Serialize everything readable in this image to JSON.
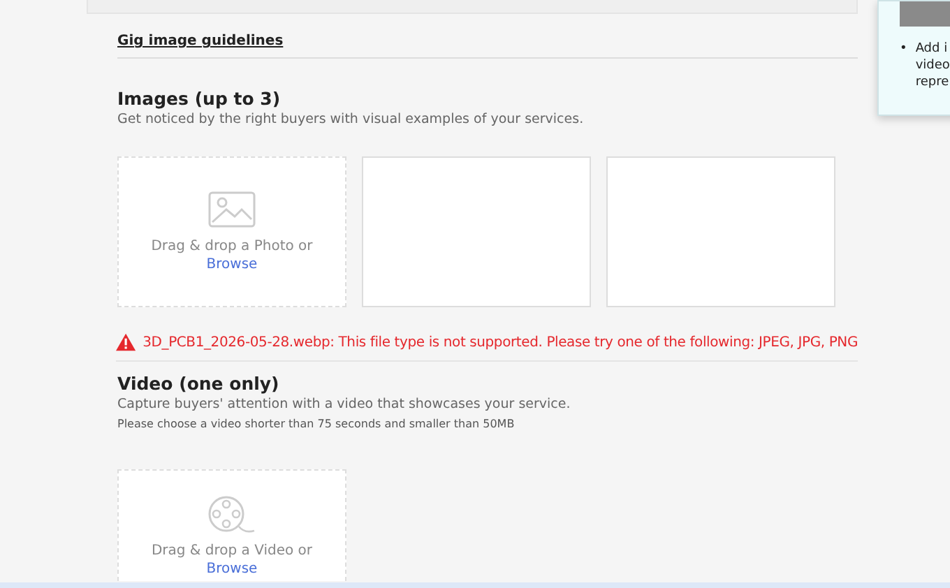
{
  "guidelines_link": "Gig image guidelines",
  "tip_panel": {
    "bullet": "•",
    "bullet_lines": [
      "Add i",
      "video",
      "repre"
    ]
  },
  "images": {
    "title": "Images (up to 3)",
    "subtitle": "Get noticed by the right buyers with visual examples of your services.",
    "slots": [
      {
        "kind": "upload",
        "prompt": "Drag & drop a Photo or",
        "link": "Browse"
      },
      {
        "kind": "empty"
      },
      {
        "kind": "empty"
      }
    ],
    "error": "3D_PCB1_2026-05-28.webp: This file type is not supported. Please try one of the following: JPEG, JPG, PNG"
  },
  "video": {
    "title": "Video (one only)",
    "subtitle": "Capture buyers' attention with a video that showcases your service.",
    "note": "Please choose a video shorter than 75 seconds and smaller than 50MB",
    "slot": {
      "prompt": "Drag & drop a Video or",
      "link": "Browse"
    }
  }
}
